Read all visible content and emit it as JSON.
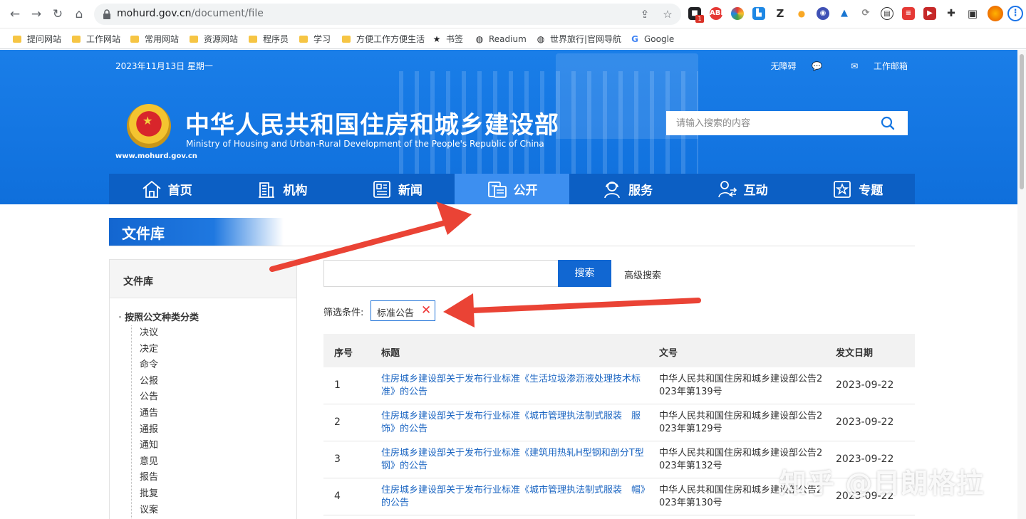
{
  "browser": {
    "url_host": "mohurd.gov.cn",
    "url_path": "/document/file",
    "extension_badge": "1",
    "bookmarks": [
      "提问网站",
      "工作网站",
      "常用网站",
      "资源网站",
      "程序员",
      "学习",
      "方便工作方便生活",
      "书签",
      "Readium",
      "世界旅行|官网导航",
      "Google"
    ]
  },
  "header": {
    "date": "2023年11月13日 星期一",
    "accessibility": "无障碍",
    "mail": "工作邮箱",
    "site_url": "www.mohurd.gov.cn",
    "title": "中华人民共和国住房和城乡建设部",
    "subtitle": "Ministry of Housing and Urban-Rural Development of the People's Republic of China",
    "search_placeholder": "请输入搜索的内容"
  },
  "nav": {
    "items": [
      {
        "label": "首页",
        "icon": "home-icon"
      },
      {
        "label": "机构",
        "icon": "building-icon"
      },
      {
        "label": "新闻",
        "icon": "news-icon"
      },
      {
        "label": "公开",
        "icon": "disclosure-icon"
      },
      {
        "label": "服务",
        "icon": "service-icon"
      },
      {
        "label": "互动",
        "icon": "interaction-icon"
      },
      {
        "label": "专题",
        "icon": "topic-icon"
      }
    ],
    "active_index": 3
  },
  "page": {
    "heading": "文件库"
  },
  "sidebar": {
    "title": "文件库",
    "category": "按照公文种类分类",
    "items": [
      "决议",
      "决定",
      "命令",
      "公报",
      "公告",
      "通告",
      "通报",
      "通知",
      "意见",
      "报告",
      "批复",
      "议案"
    ]
  },
  "search": {
    "keyword_value": "",
    "button": "搜索",
    "advanced": "高级搜索"
  },
  "filter": {
    "label": "筛选条件:",
    "tag": "标准公告",
    "remove": "✕"
  },
  "table": {
    "headers": [
      "序号",
      "标题",
      "文号",
      "发文日期"
    ],
    "rows": [
      {
        "no": "1",
        "title": "住房城乡建设部关于发布行业标准《生活垃圾渗沥液处理技术标准》的公告",
        "doc": "中华人民共和国住房和城乡建设部公告2023年第139号",
        "date": "2023-09-22"
      },
      {
        "no": "2",
        "title": "住房城乡建设部关于发布行业标准《城市管理执法制式服装　服饰》的公告",
        "doc": "中华人民共和国住房和城乡建设部公告2023年第129号",
        "date": "2023-09-22"
      },
      {
        "no": "3",
        "title": "住房城乡建设部关于发布行业标准《建筑用热轧H型钢和剖分T型钢》的公告",
        "doc": "中华人民共和国住房和城乡建设部公告2023年第132号",
        "date": "2023-09-22"
      },
      {
        "no": "4",
        "title": "住房城乡建设部关于发布行业标准《城市管理执法制式服装　帽》的公告",
        "doc": "中华人民共和国住房和城乡建设部公告2023年第130号",
        "date": "2023-09-22"
      }
    ]
  },
  "watermark": "知乎 @日朗格拉",
  "colors": {
    "brand_blue": "#1476e2",
    "nav_blue": "#0c5fc4",
    "nav_active": "#3d8ff0",
    "link_blue": "#1c66c2",
    "arrow_red": "#ea4335"
  }
}
